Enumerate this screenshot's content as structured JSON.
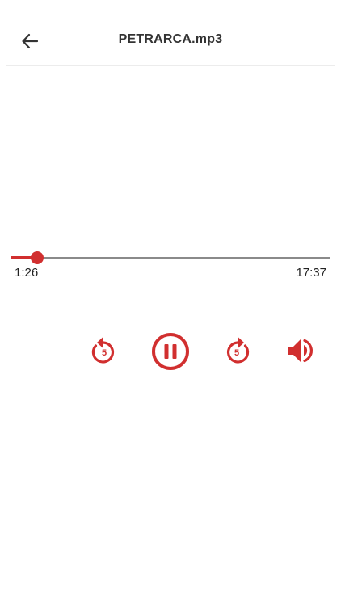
{
  "header": {
    "title": "PETRARCA.mp3",
    "back_icon": "arrow-left-icon"
  },
  "player": {
    "elapsed": "1:26",
    "duration": "17:37",
    "progress": 0.081,
    "accent_color": "#d12f2f"
  },
  "controls": {
    "rewind_icon": "replay-5-icon",
    "rewind_seconds": "5",
    "pause_icon": "pause-circle-icon",
    "forward_icon": "forward-5-icon",
    "forward_seconds": "5",
    "volume_icon": "volume-icon"
  }
}
